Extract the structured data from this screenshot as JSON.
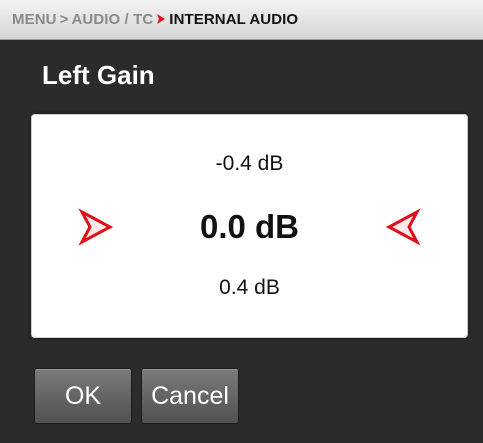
{
  "breadcrumb": {
    "items": [
      "MENU",
      "AUDIO / TC"
    ],
    "current": "INTERNAL AUDIO",
    "separator_icon": "chevron-right-icon",
    "active_color": "#e0101b"
  },
  "page": {
    "title": "Left Gain"
  },
  "gain_picker": {
    "previous_value": "-0.4 dB",
    "current_value": "0.0 dB",
    "next_value": "0.4 dB",
    "left_icon": "triangle-right-icon",
    "right_icon": "triangle-left-icon",
    "arrow_color": "#e0101b"
  },
  "buttons": {
    "ok_label": "OK",
    "cancel_label": "Cancel"
  }
}
